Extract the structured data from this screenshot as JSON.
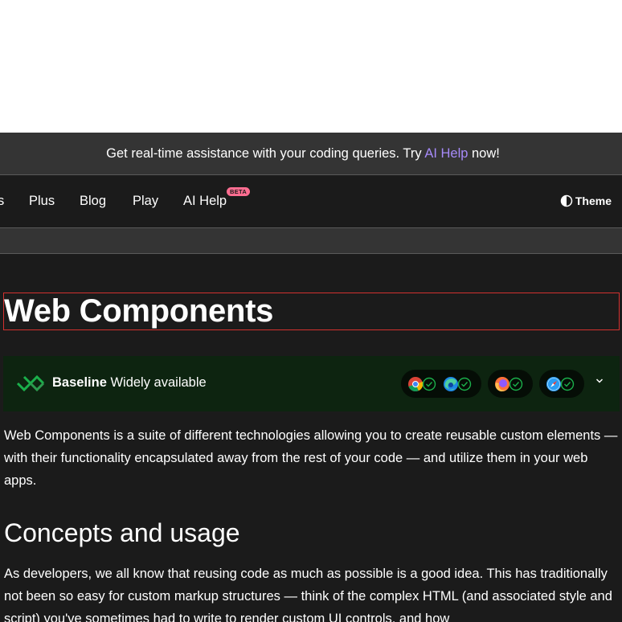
{
  "banner": {
    "text_before": "Get real-time assistance with your coding queries. Try ",
    "link": "AI Help",
    "text_after": " now!"
  },
  "nav": {
    "partial": "s",
    "items": [
      "Plus",
      "Blog",
      "Play",
      "AI Help"
    ],
    "beta": "BETA",
    "theme": "Theme"
  },
  "article": {
    "title": "Web Components",
    "baseline": {
      "label": "Baseline",
      "status": "Widely available",
      "browsers": [
        "chrome-icon",
        "edge-icon",
        "firefox-icon",
        "safari-icon"
      ]
    },
    "intro": "Web Components is a suite of different technologies allowing you to create reusable custom elements — with their functionality encapsulated away from the rest of your code — and utilize them in your web apps.",
    "section_heading": "Concepts and usage",
    "section_text": "As developers, we all know that reusing code as much as possible is a good idea. This has traditionally not been so easy for custom markup structures — think of the complex HTML (and associated style and script) you've sometimes had to write to render custom UI controls, and how"
  },
  "colors": {
    "background": "#1b1b1b",
    "banner": "#343434",
    "link": "#a78bfa",
    "beta": "#ff6d91",
    "baseline_bg": "#0d2410",
    "check": "#1bb04b"
  }
}
